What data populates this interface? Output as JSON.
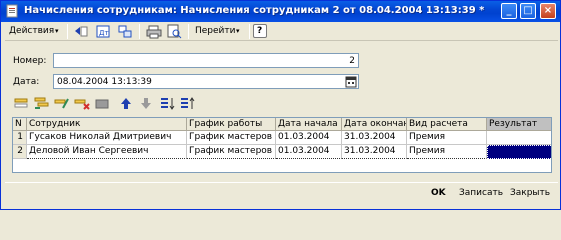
{
  "window": {
    "title": "Начисления сотрудникам: Начисления сотрудникам 2 от 08.04.2004 13:13:39 *",
    "controls": [
      "_",
      "□",
      "×"
    ]
  },
  "toolbar": {
    "actions_label": "Действия",
    "goto_label": "Перейти",
    "help_label": "?"
  },
  "form": {
    "number_label": "Номер:",
    "number_value": "2",
    "date_label": "Дата:",
    "date_value": "08.04.2004 13:13:39"
  },
  "table": {
    "columns": [
      "N",
      "Сотрудник",
      "График работы",
      "Дата начала",
      "Дата окончания",
      "Вид расчета",
      "Результат"
    ],
    "rows": [
      [
        "1",
        "Гусаков Николай Дмитриевич",
        "График мастеров",
        "01.03.2004",
        "31.03.2004",
        "Премия",
        ""
      ],
      [
        "2",
        "Деловой Иван Сергеевич",
        "График мастеров",
        "01.03.2004",
        "31.03.2004",
        "Премия",
        ""
      ]
    ]
  },
  "footer": {
    "ok_label": "OK",
    "save_label": "Записать",
    "close_label": "Закрыть"
  },
  "colors": {
    "titlebar": "#0346D3",
    "selection": "#000080"
  }
}
